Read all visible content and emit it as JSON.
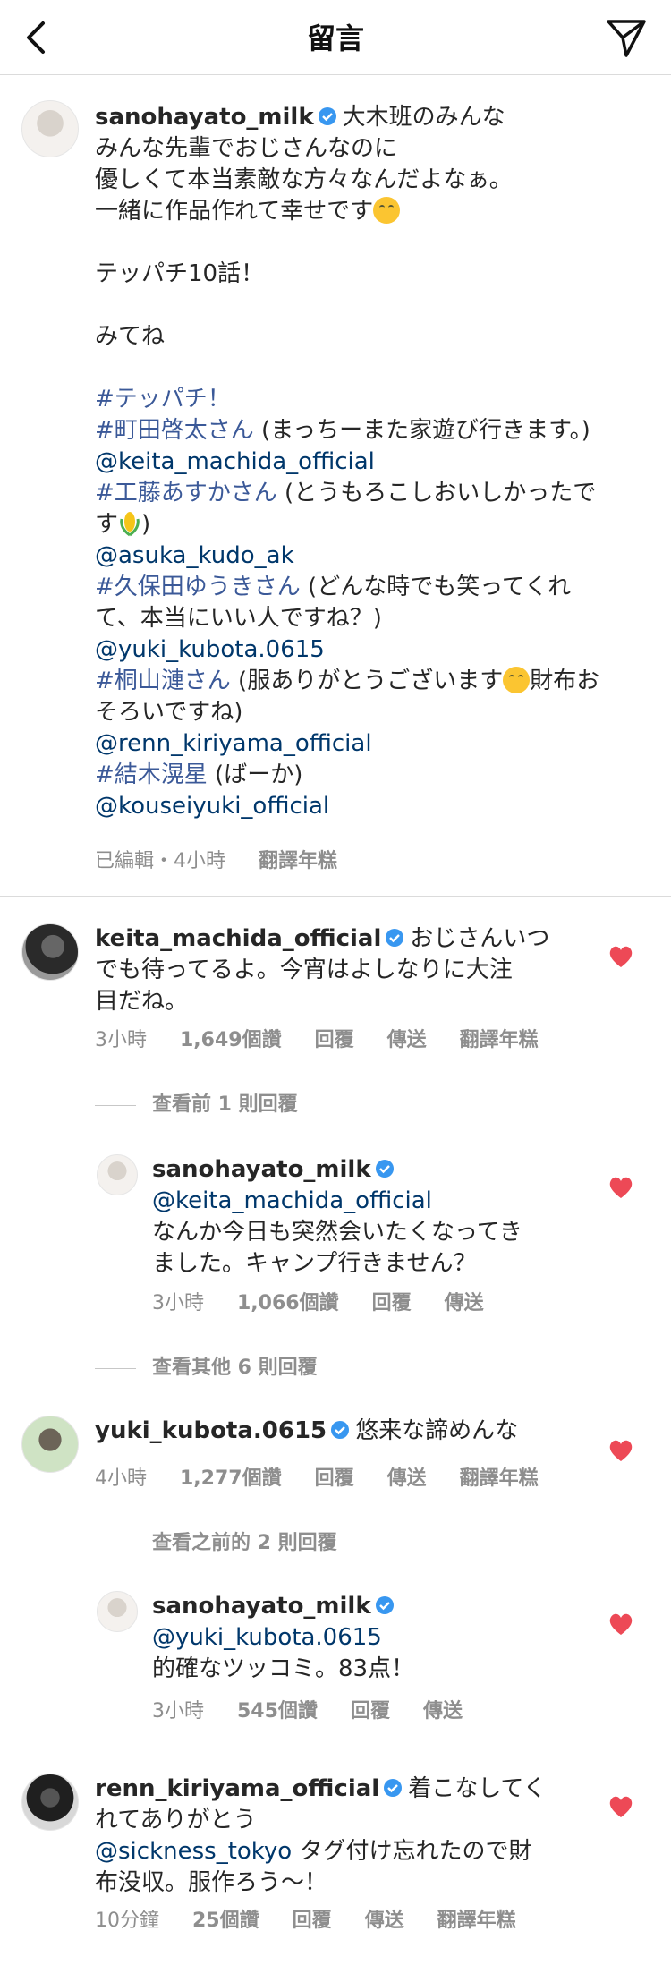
{
  "header": {
    "title": "留言"
  },
  "caption": {
    "username": "sanohayato_milk",
    "line1": "大木班のみんな",
    "line2": "みんな先輩でおじさんなのに",
    "line3": "優しくて本当素敵な方々なんだよなぁ。",
    "line4": "一緒に作品作れて幸せです",
    "line5": "テッパチ10話！",
    "line6": "みてね",
    "tag1": "#テッパチ！",
    "tag2": "#町田啓太さん",
    "tag2_note": " (まっちーまた家遊び行きます。)",
    "mention2": "@keita_machida_official",
    "tag3": "#工藤あすかさん",
    "tag3_note_a": " (とうもろこしおいしかったで",
    "tag3_note_b": "す",
    "tag3_note_c": ")",
    "mention3": "@asuka_kudo_ak",
    "tag4": "#久保田ゆうきさん",
    "tag4_note_a": " (どんな時でも笑ってくれ",
    "tag4_note_b": "て、本当にいい人ですね？)",
    "mention4": "@yuki_kubota.0615",
    "tag5": "#桐山漣さん",
    "tag5_note_a": " (服ありがとうございます",
    "tag5_note_b": "財布お",
    "tag5_note_c": "そろいですね)",
    "mention5": "@renn_kiriyama_official",
    "tag6": "#結木滉星",
    "tag6_note": " (ばーか)",
    "mention6": "@kouseiyuki_official",
    "meta": "已編輯・4小時",
    "translate": "翻譯年糕"
  },
  "comments": [
    {
      "username": "keita_machida_official",
      "text_a": "おじさんいつ",
      "text_b": "でも待ってるよ。今宵はよしなりに大注",
      "text_c": "目だね。",
      "time": "3小時",
      "likes": "1,649個讚",
      "reply": "回覆",
      "send": "傳送",
      "translate": "翻譯年糕",
      "view_replies": "查看前 1 則回覆"
    },
    {
      "username": "sanohayato_milk",
      "mention": "@keita_machida_official",
      "text_a": "なんか今日も突然会いたくなってき",
      "text_b": "ました。キャンプ行きません？",
      "time": "3小時",
      "likes": "1,066個讚",
      "reply": "回覆",
      "send": "傳送",
      "view_replies": "查看其他 6 則回覆"
    },
    {
      "username": "yuki_kubota.0615",
      "text_a": "悠来な諦めんな",
      "time": "4小時",
      "likes": "1,277個讚",
      "reply": "回覆",
      "send": "傳送",
      "translate": "翻譯年糕",
      "view_replies": "查看之前的 2 則回覆"
    },
    {
      "username": "sanohayato_milk",
      "mention": "@yuki_kubota.0615",
      "text_a": "的確なツッコミ。83点！",
      "time": "3小時",
      "likes": "545個讚",
      "reply": "回覆",
      "send": "傳送"
    },
    {
      "username": "renn_kiriyama_official",
      "text_a": "着こなしてく",
      "text_b": "れてありがとう",
      "mention": "@sickness_tokyo",
      "text_c": " タグ付け忘れたので財",
      "text_d": "布没収。服作ろう〜！",
      "time": "10分鐘",
      "likes": "25個讚",
      "reply": "回覆",
      "send": "傳送",
      "translate": "翻譯年糕"
    }
  ],
  "colors": {
    "link": "#00376b",
    "heart": "#ed4956",
    "verified": "#3897f0",
    "meta": "#8e8e8e"
  }
}
